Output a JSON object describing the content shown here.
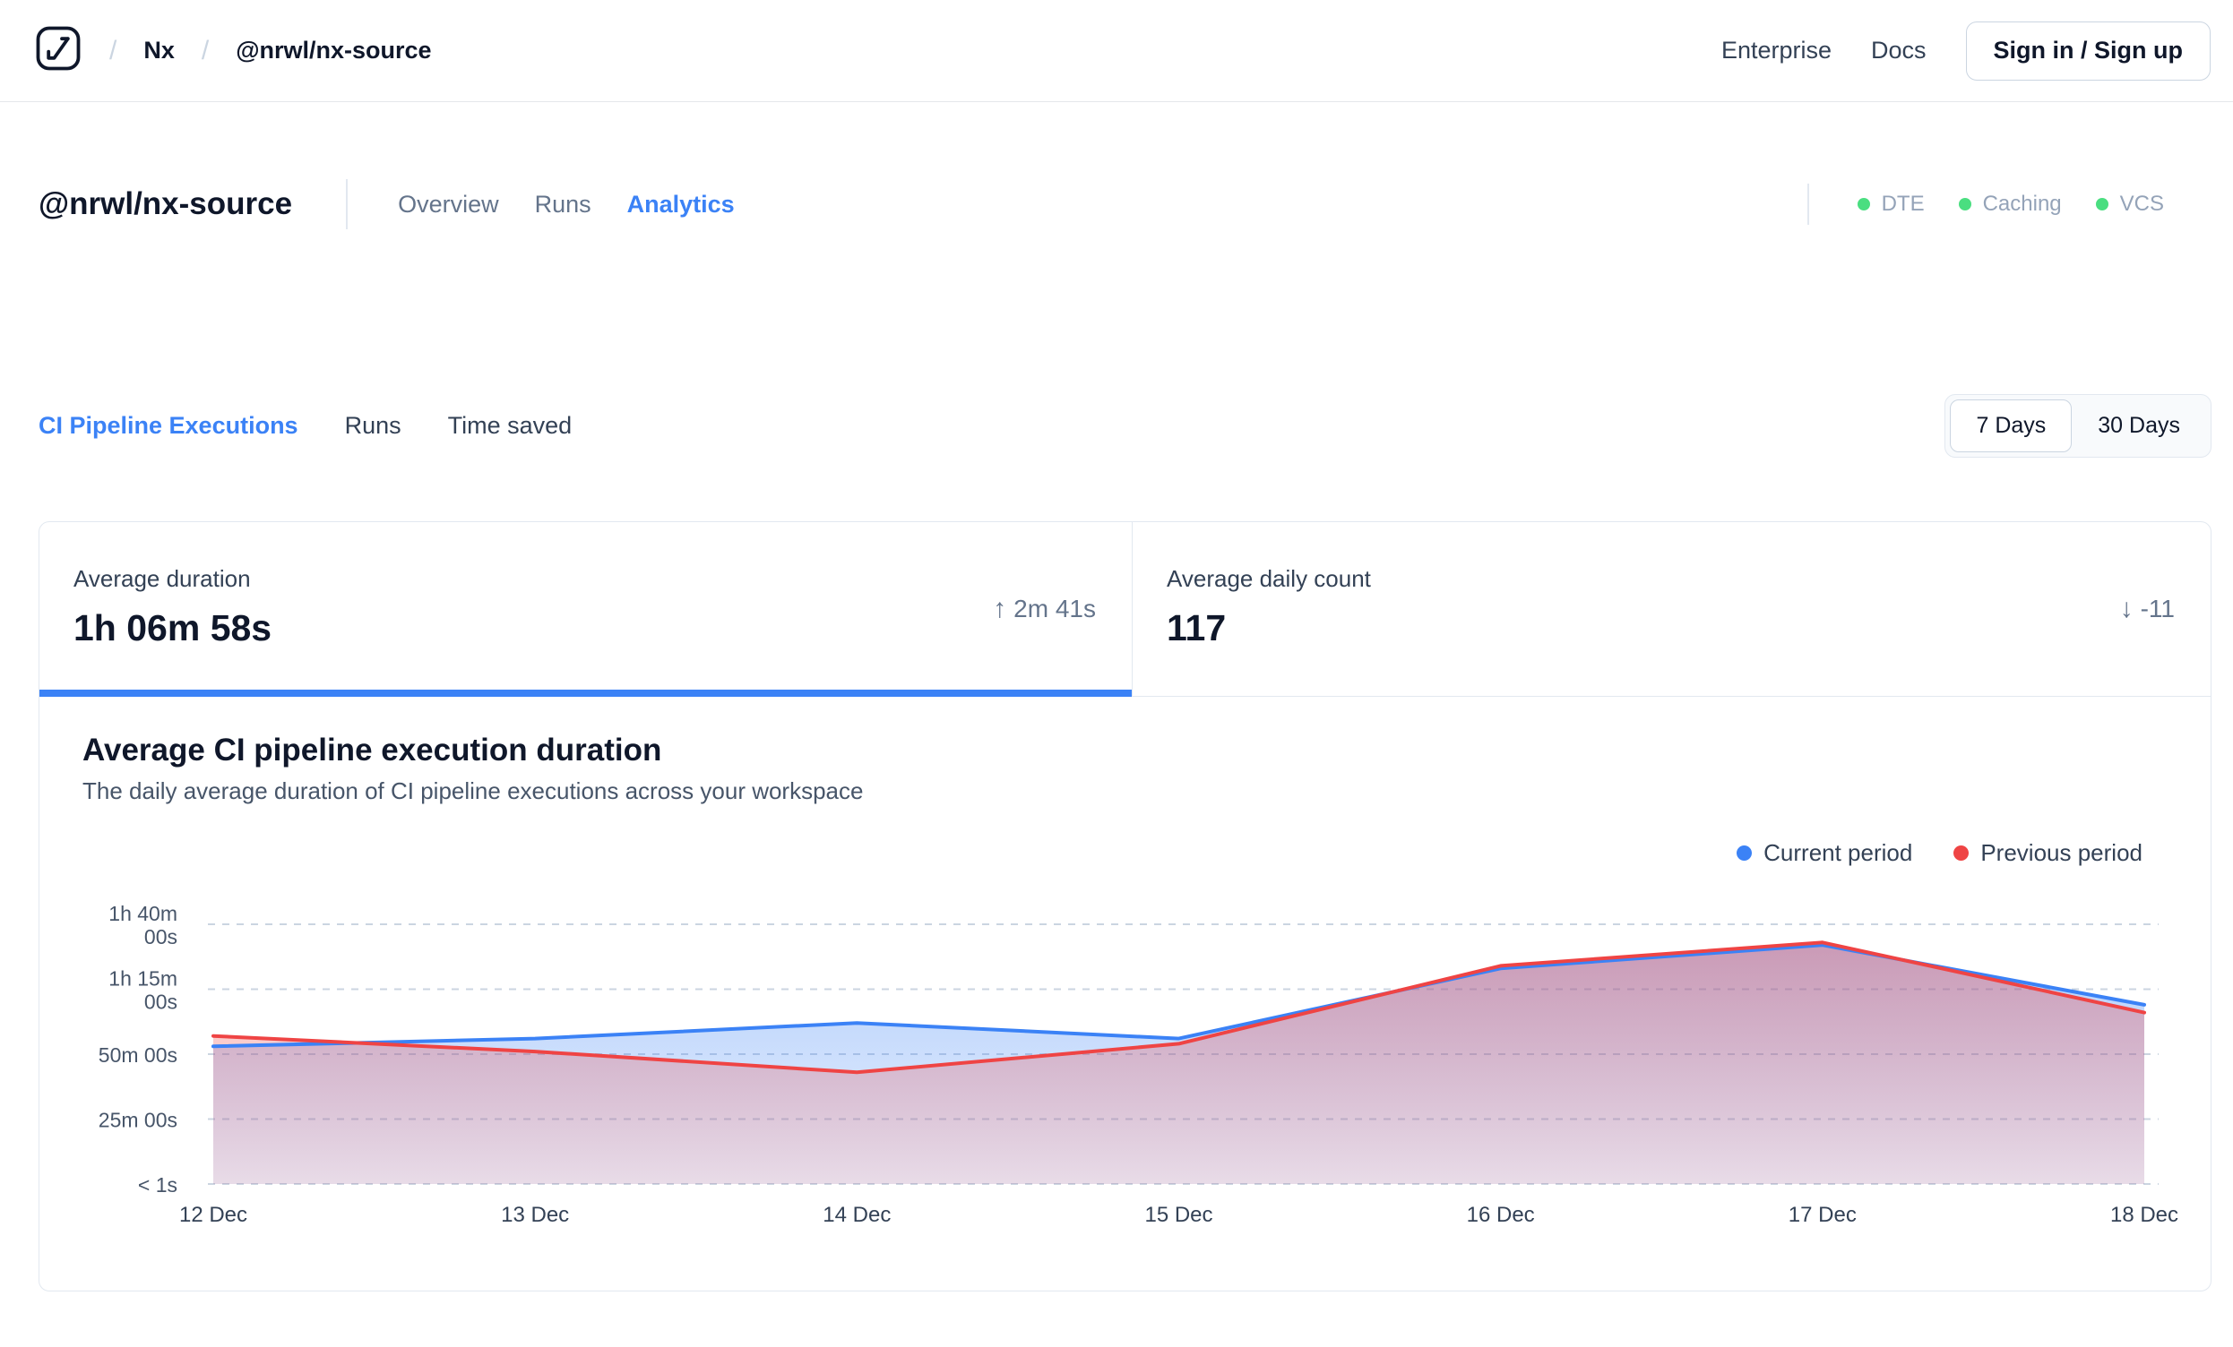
{
  "icons": {
    "arrow_up": "↑",
    "arrow_down": "↓"
  },
  "header": {
    "breadcrumb": {
      "sep": "/",
      "org": "Nx",
      "repo": "@nrwl/nx-source"
    },
    "links": {
      "enterprise": "Enterprise",
      "docs": "Docs"
    },
    "signin_label": "Sign in / Sign up"
  },
  "workspace": {
    "title": "@nrwl/nx-source",
    "tabs": [
      {
        "label": "Overview"
      },
      {
        "label": "Runs"
      },
      {
        "label": "Analytics"
      }
    ],
    "active_tab": "Analytics",
    "status_color": "#4ade80",
    "status": [
      {
        "label": "DTE"
      },
      {
        "label": "Caching"
      },
      {
        "label": "VCS"
      }
    ]
  },
  "analytics": {
    "tabs": [
      {
        "label": "CI Pipeline Executions"
      },
      {
        "label": "Runs"
      },
      {
        "label": "Time saved"
      }
    ],
    "active_tab": "CI Pipeline Executions",
    "range_toggle": {
      "options": [
        "7 Days",
        "30 Days"
      ],
      "selected": "7 Days"
    }
  },
  "stats": [
    {
      "label": "Average duration",
      "value": "1h 06m 58s",
      "delta": "2m 41s",
      "delta_direction": "up",
      "active": true
    },
    {
      "label": "Average daily count",
      "value": "117",
      "delta": "-11",
      "delta_direction": "down",
      "active": false
    }
  ],
  "chart": {
    "title": "Average CI pipeline execution duration",
    "subtitle": "The daily average duration of CI pipeline executions across your workspace",
    "legend": [
      {
        "label": "Current period",
        "color": "#3b82f6"
      },
      {
        "label": "Previous period",
        "color": "#ef4444"
      }
    ]
  },
  "chart_data": {
    "type": "line",
    "title": "Average CI pipeline execution duration",
    "x": [
      "12 Dec",
      "13 Dec",
      "14 Dec",
      "15 Dec",
      "16 Dec",
      "17 Dec",
      "18 Dec"
    ],
    "series": [
      {
        "name": "Current period",
        "color": "#3b82f6",
        "values_minutes": [
          53,
          56,
          62,
          56,
          83,
          92,
          69
        ]
      },
      {
        "name": "Previous period",
        "color": "#ef4444",
        "values_minutes": [
          57,
          51,
          43,
          54,
          84,
          93,
          66
        ]
      }
    ],
    "y_ticks": [
      {
        "minutes": 100,
        "label": "1h 40m\n00s"
      },
      {
        "minutes": 75,
        "label": "1h 15m\n00s"
      },
      {
        "minutes": 50,
        "label": "50m 00s"
      },
      {
        "minutes": 25,
        "label": "25m 00s"
      },
      {
        "minutes": 0,
        "label": "< 1s"
      }
    ],
    "ylim_minutes": [
      0,
      100
    ],
    "area_fill": true,
    "grid": "dashed-horizontal",
    "legend_position": "top-right"
  }
}
